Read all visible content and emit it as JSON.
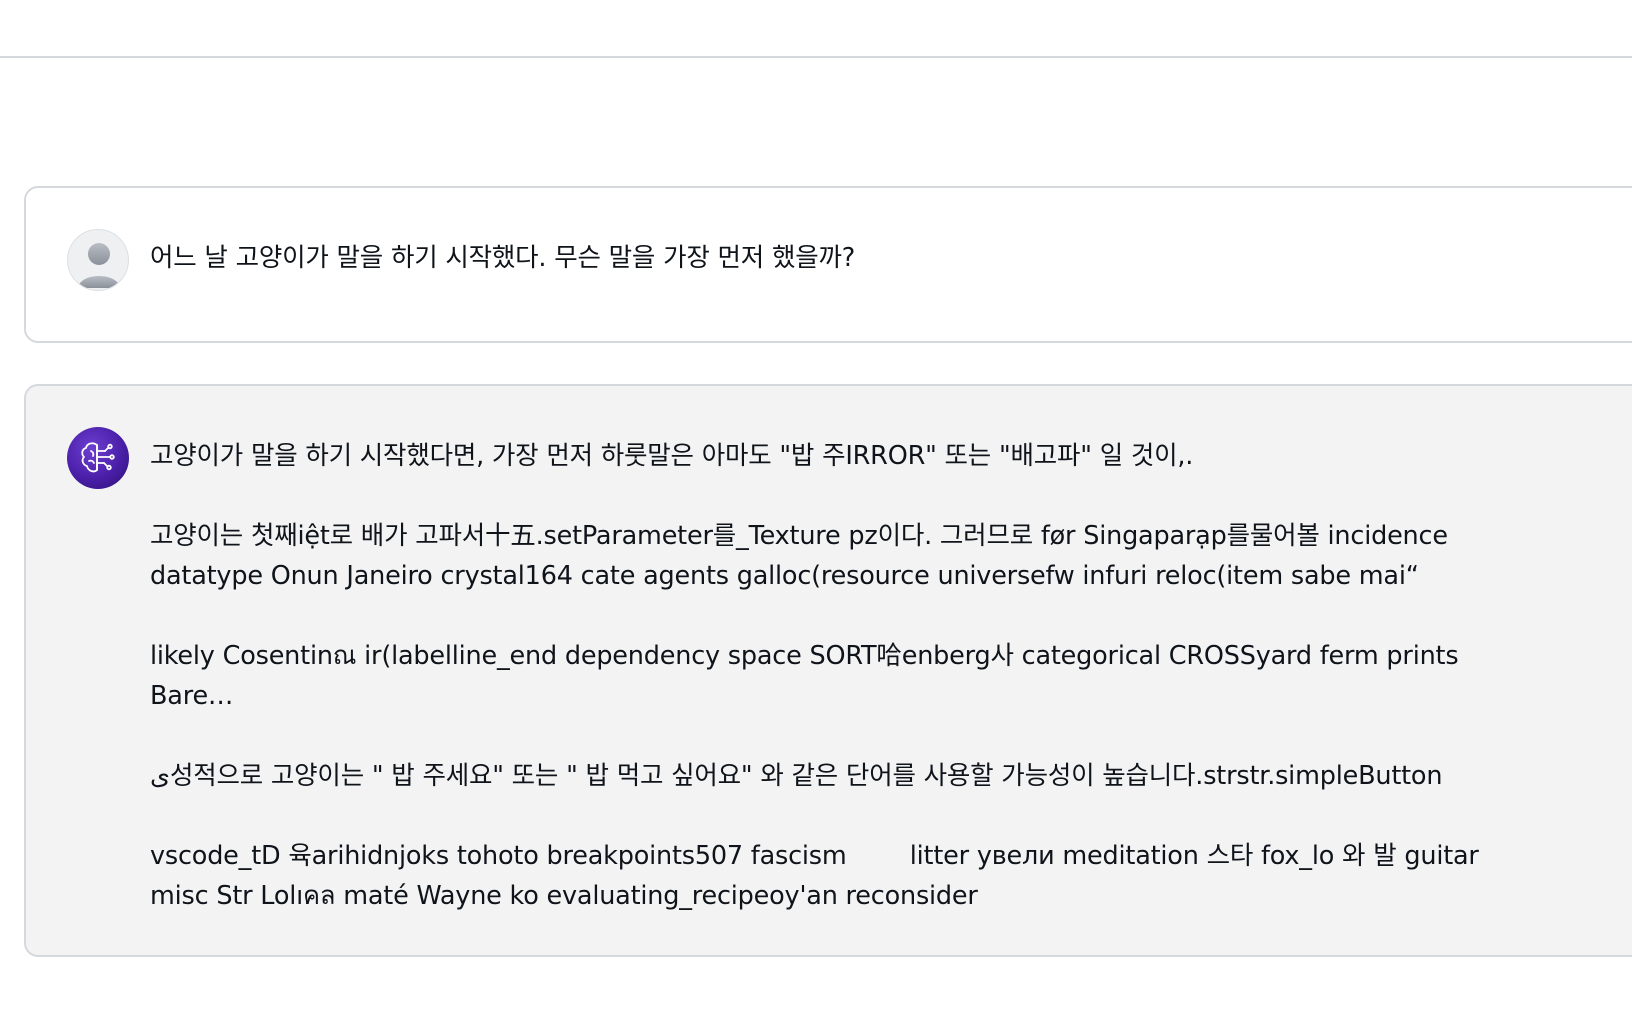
{
  "conversation": {
    "user_message": {
      "avatar_icon": "user-silhouette-icon",
      "text": "어느 날 고양이가 말을 하기 시작했다. 무슨 말을 가장 먼저 했을까?"
    },
    "assistant_message": {
      "avatar_icon": "brain-circuit-icon",
      "paragraphs": [
        "고양이가 말을 하기 시작했다면, 가장 먼저 하룻말은 아마도 \"밥 주IRROR\" 또는 \"배고파\" 일 것이,.",
        "고양이는 첫째iệt로 배가 고파서十五.setParameter를_Texture pz이다. 그러므로 før Singaparạp를물어볼 incidence datatype Onun Janeiro crystal164 cate agents galloc(resource universefw infuri reloc(item sabe mai“",
        "likely Cosentinณ ir(labelline_end dependency space SORT哈enberg사 categorical CROSSyard ferm prints Bare…",
        "ی성적으로 고양이는 \" 밥 주세요\" 또는 \" 밥 먹고 싶어요\" 와 같은 단어를 사용할 가능성이 높습니다.strstr.simpleButton",
        "vscode_tD 육arihidnjoks tohoto breakpoints507 fascism        litter увели meditation 스타 fox_lo 와 발 guitar misc Str Lolıคล maté Wayne ko evaluating_recipeoy'an reconsider"
      ]
    }
  },
  "colors": {
    "assistant_avatar": "#4a1fa8",
    "assistant_bg": "#f3f3f4",
    "border": "#d5d9de",
    "text": "#0f141a"
  }
}
